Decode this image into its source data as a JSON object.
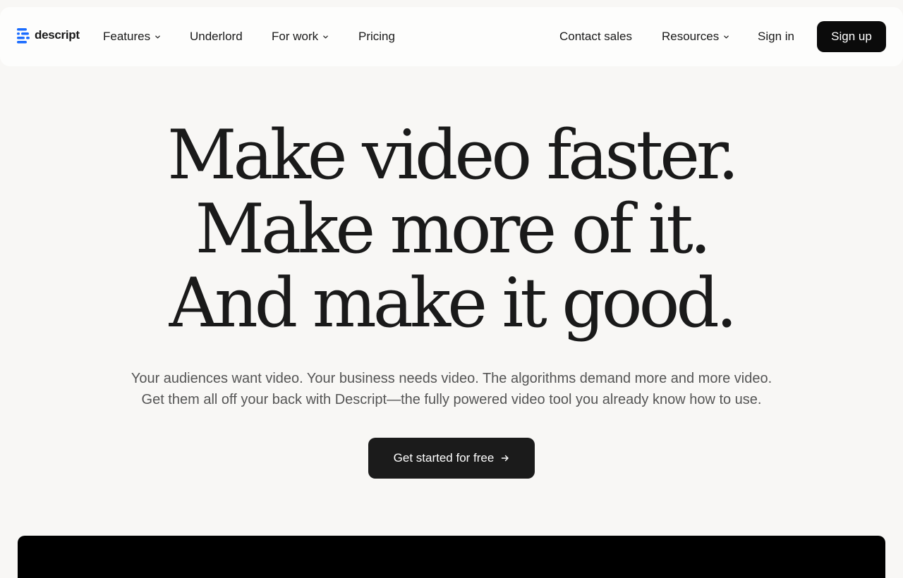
{
  "nav": {
    "logo_text": "descript",
    "features": "Features",
    "underlord": "Underlord",
    "for_work": "For work",
    "pricing": "Pricing",
    "contact_sales": "Contact sales",
    "resources": "Resources",
    "sign_in": "Sign in",
    "sign_up": "Sign up"
  },
  "hero": {
    "title_lines": [
      "Make video faster.",
      "Make more of it.",
      "And make it good."
    ],
    "subtitle_lines": [
      "Your audiences want video. Your business needs video. The algorithms demand more and more video.",
      "Get them all off your back with Descript—the fully powered video tool you already know how to use."
    ],
    "cta_label": "Get started for free"
  },
  "icons": {
    "logo": "descript-logo-icon",
    "dropdown": "chevron-down-icon",
    "cta": "arrow-right-icon"
  },
  "colors": {
    "background": "#f8f7f5",
    "brand_blue": "#1a6cff",
    "button_dark": "#0b0b0b"
  }
}
